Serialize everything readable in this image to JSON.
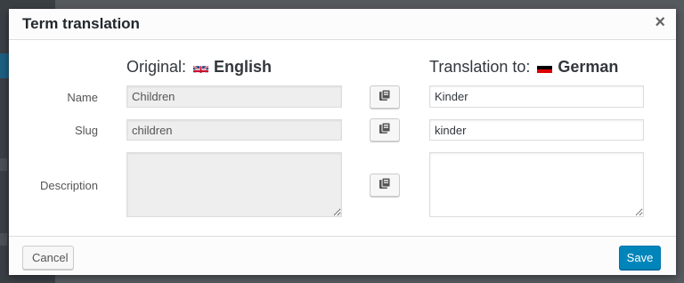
{
  "dialog": {
    "title": "Term translation",
    "close_symbol": "×"
  },
  "original": {
    "label": "Original:",
    "language": "English",
    "flag_icon": "uk-flag-icon"
  },
  "translation": {
    "label": "Translation to:",
    "language": "German",
    "flag_icon": "germany-flag-icon"
  },
  "fields": [
    {
      "label": "Name",
      "original_value": "Children",
      "translated_value": "Kinder"
    },
    {
      "label": "Slug",
      "original_value": "children",
      "translated_value": "kinder"
    },
    {
      "label": "Description",
      "original_value": "",
      "translated_value": ""
    }
  ],
  "copy_icon": "copy-icon",
  "footer": {
    "cancel_label": "Cancel",
    "save_label": "Save"
  },
  "colors": {
    "primary": "#0085ba",
    "readonly_bg": "#eeeeee"
  }
}
